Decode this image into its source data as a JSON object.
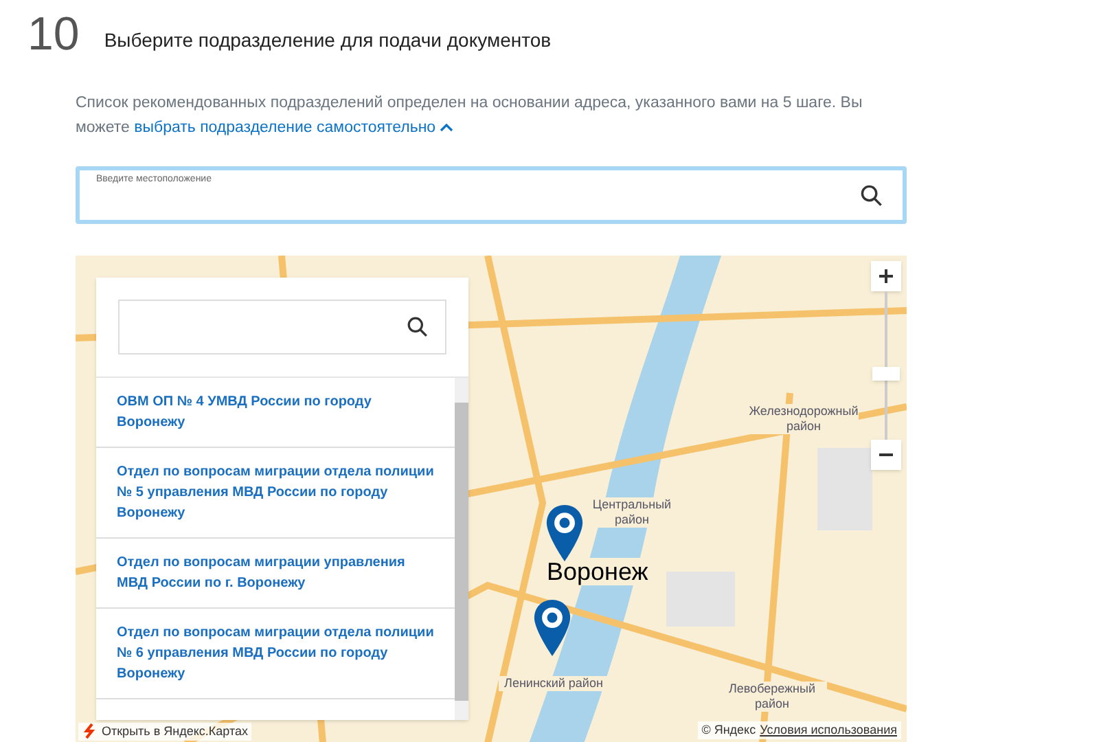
{
  "step": {
    "number": "10",
    "title": "Выберите подразделение для подачи документов"
  },
  "description": {
    "text": "Список рекомендованных подразделений определен на основании адреса, указанного вами на 5 шаге. Вы можете ",
    "link": "выбрать подразделение самостоятельно",
    "expanded": true
  },
  "location_field": {
    "placeholder": "Введите местоположение"
  },
  "map": {
    "labels": [
      {
        "text": "Центральный район",
        "kind": "district"
      },
      {
        "text": "Воронеж",
        "kind": "city"
      },
      {
        "text": "Ленинский район",
        "kind": "district"
      },
      {
        "text": "Железнодорожный район",
        "kind": "district"
      },
      {
        "text": "Левобережный район",
        "kind": "district"
      }
    ],
    "open_link": "Открыть в Яндекс.Картах",
    "copyright": "© Яндекс",
    "terms_link": "Условия использования"
  },
  "panel": {
    "items": [
      {
        "name": "ОВМ ОП № 4 УМВД России по городу Воронежу"
      },
      {
        "name": "Отдел по вопросам миграции отдела полиции № 5 управления МВД России по городу Воронежу"
      },
      {
        "name": "Отдел по вопросам миграции управления МВД России по г. Воронежу"
      },
      {
        "name": "Отдел по вопросам миграции отдела полиции № 6 управления МВД России по городу Воронежу"
      }
    ]
  }
}
